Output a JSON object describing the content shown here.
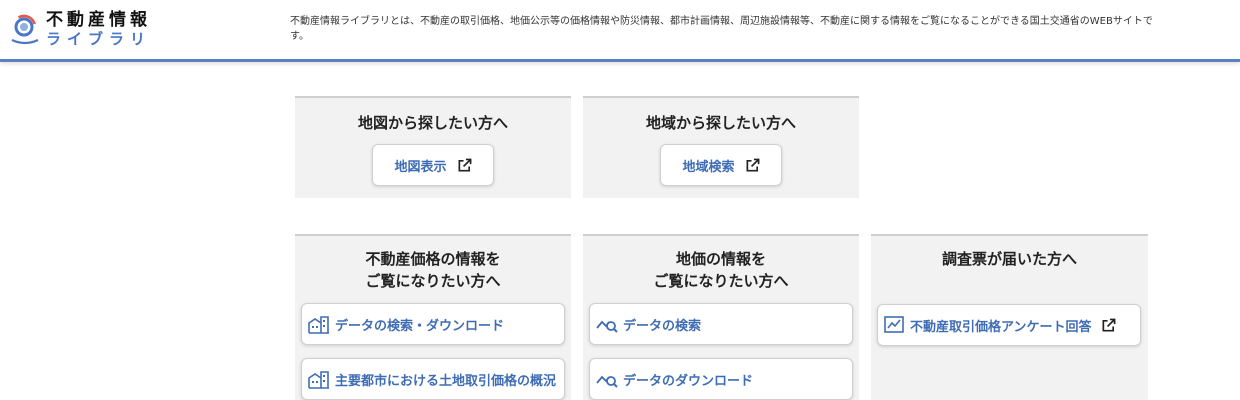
{
  "header": {
    "logo_main": "不動産情報",
    "logo_sub": "ライブラリ",
    "tagline": "不動産情報ライブラリとは、不動産の取引価格、地価公示等の価格情報や防災情報、都市計画情報、周辺施設情報等、不動産に関する情報をご覧になることができる国土交通省のWEBサイトです。"
  },
  "cards": {
    "map": {
      "title": "地図から探したい方へ",
      "button": "地図表示"
    },
    "region": {
      "title": "地域から探したい方へ",
      "button": "地域検索"
    },
    "price": {
      "title_line1": "不動産価格の情報を",
      "title_line2": "ご覧になりたい方へ",
      "button1": "データの検索・ダウンロード",
      "button2": "主要都市における土地取引価格の概況"
    },
    "land": {
      "title_line1": "地価の情報を",
      "title_line2": "ご覧になりたい方へ",
      "button1": "データの検索",
      "button2": "データのダウンロード"
    },
    "survey": {
      "title": "調査票が届いた方へ",
      "button": "不動産取引価格アンケート回答"
    }
  },
  "icons": {
    "logo": "logo-swirl-icon",
    "external": "external-link-icon",
    "building": "building-icon",
    "chart_search": "chart-search-icon",
    "survey": "survey-form-icon"
  },
  "colors": {
    "accent": "#4a76c8",
    "link": "#3f6db5",
    "header_border": "#5b7fbf",
    "card_bg": "#f2f2f2"
  }
}
